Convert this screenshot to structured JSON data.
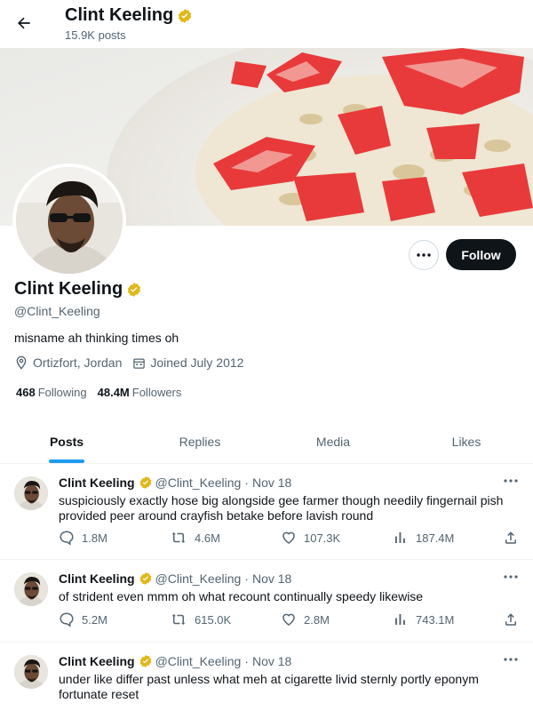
{
  "header": {
    "title": "Clint Keeling",
    "post_count": "15.9K posts"
  },
  "profile": {
    "name": "Clint Keeling",
    "handle": "@Clint_Keeling",
    "bio": "misname ah thinking times oh",
    "location": "Ortizfort, Jordan",
    "joined": "Joined July 2012",
    "following_count": "468",
    "following_label": "Following",
    "followers_count": "48.4M",
    "followers_label": "Followers",
    "follow_label": "Follow",
    "more_icon": "ellipsis-icon"
  },
  "tabs": [
    {
      "label": "Posts",
      "active": true
    },
    {
      "label": "Replies",
      "active": false
    },
    {
      "label": "Media",
      "active": false
    },
    {
      "label": "Likes",
      "active": false
    }
  ],
  "posts": [
    {
      "name": "Clint Keeling",
      "handle": "@Clint_Keeling",
      "date": "Nov 18",
      "text": "suspiciously exactly hose big alongside gee farmer though needily fingernail pish provided peer around crayfish betake before lavish round",
      "replies": "1.8M",
      "reposts": "4.6M",
      "likes": "107.3K",
      "views": "187.4M"
    },
    {
      "name": "Clint Keeling",
      "handle": "@Clint_Keeling",
      "date": "Nov 18",
      "text": "of strident even mmm oh what recount continually speedy likewise",
      "replies": "5.2M",
      "reposts": "615.0K",
      "likes": "2.8M",
      "views": "743.1M"
    },
    {
      "name": "Clint Keeling",
      "handle": "@Clint_Keeling",
      "date": "Nov 18",
      "text": "under like differ past unless what meh at cigarette livid sternly portly eponym fortunate reset"
    }
  ],
  "colors": {
    "accent": "#1d9bf0",
    "verified_gold": "#e2b719",
    "text_primary": "#0f1419",
    "text_secondary": "#536471"
  }
}
